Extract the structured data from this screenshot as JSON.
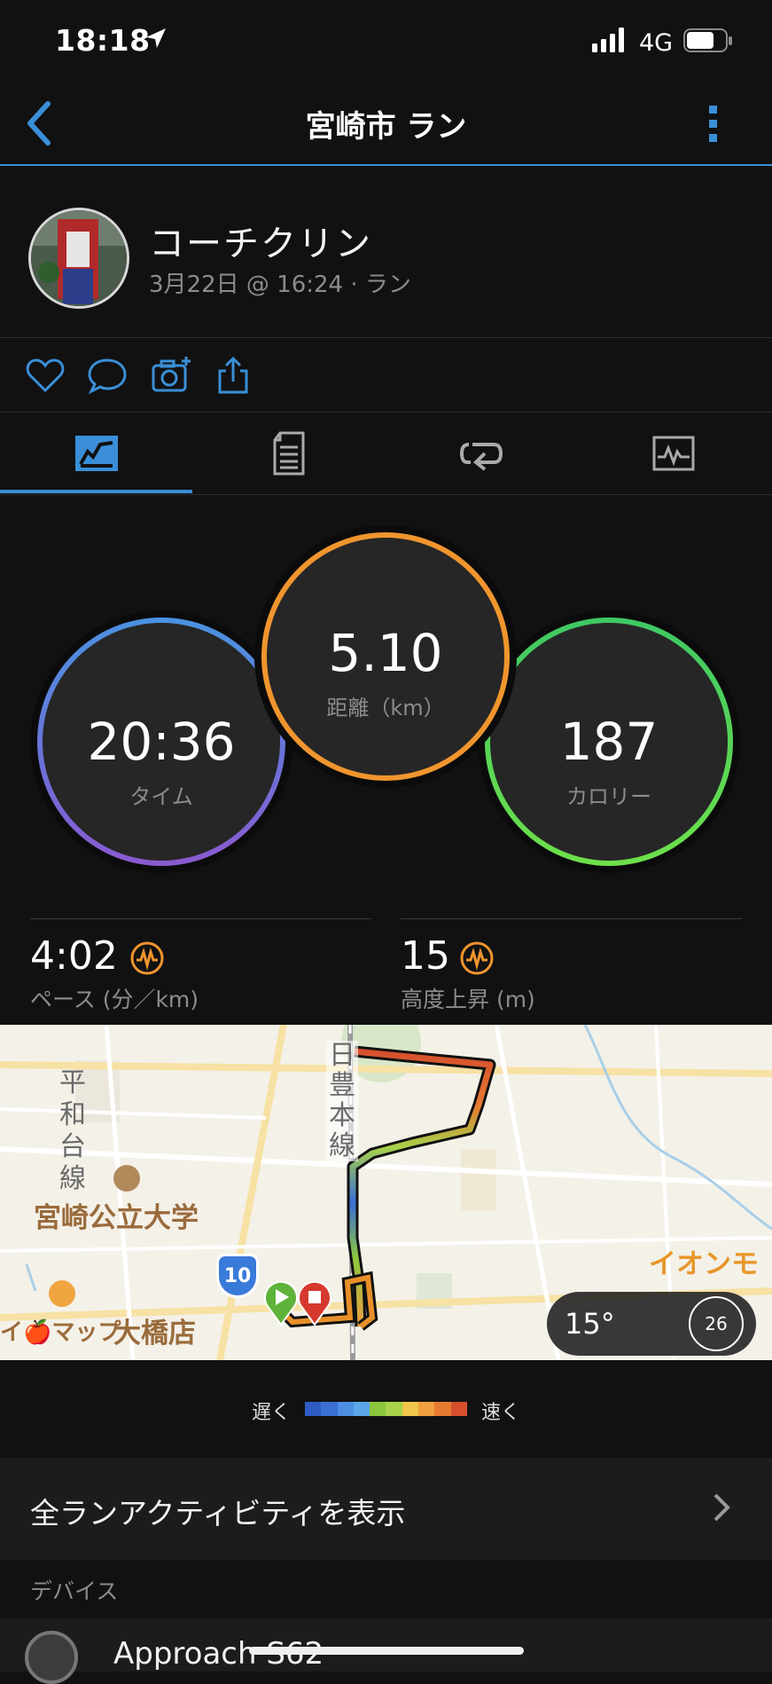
{
  "status_bar": {
    "time": "18:18",
    "network": "4G"
  },
  "header": {
    "title": "宮崎市 ラン"
  },
  "profile": {
    "name": "コーチクリン",
    "subtitle": "3月22日 @ 16:24 · ラン"
  },
  "stats": {
    "time": {
      "value": "20:36",
      "label": "タイム"
    },
    "distance": {
      "value": "5.10",
      "label": "距離（km）"
    },
    "calories": {
      "value": "187",
      "label": "カロリー"
    },
    "pace": {
      "value": "4:02",
      "label": "ペース (分／km)"
    },
    "elevation": {
      "value": "15",
      "label": "高度上昇 (m)"
    }
  },
  "map": {
    "labels": {
      "rail_line": "日豊本線",
      "route_left": "平和台線",
      "university": "宮崎公立大学",
      "store_left": "イ🍎マップ",
      "store": "大橋店",
      "store_right": "イオンモ",
      "highway": "10"
    },
    "weather": {
      "temperature": "15°",
      "wind": "26"
    }
  },
  "legend": {
    "slow": "遅く",
    "fast": "速く",
    "colors": [
      "#2f5cc4",
      "#3a6fd6",
      "#4d8ee3",
      "#5ba6e9",
      "#8cc63f",
      "#a8d24a",
      "#f0c74a",
      "#f0a040",
      "#e57b30",
      "#d6502e"
    ]
  },
  "all_activities": {
    "label": "全ランアクティビティを表示"
  },
  "devices": {
    "heading": "デバイス",
    "name": "Approach S62"
  },
  "colors": {
    "accent": "#3a8fd8",
    "time_ring": "#6a73d8",
    "distance_ring": "#f0952e",
    "calorie_ring": "#4fd46a",
    "badge": "#f0952e"
  }
}
